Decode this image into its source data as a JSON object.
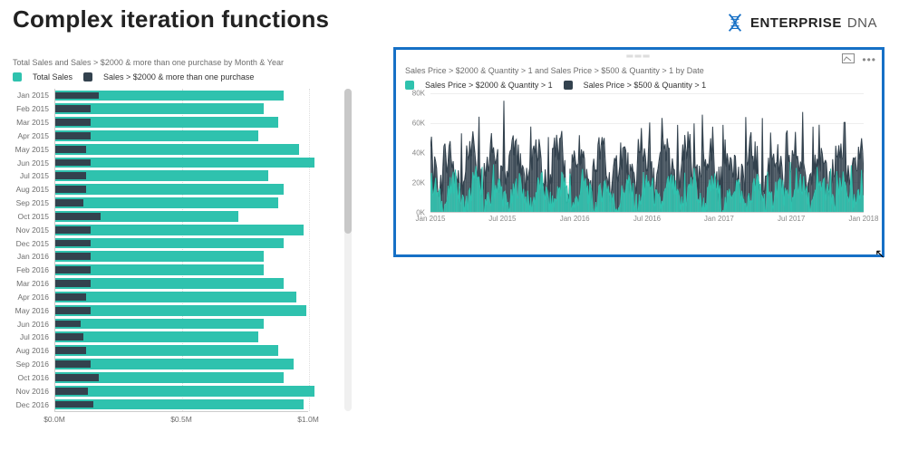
{
  "header": {
    "title": "Complex iteration functions"
  },
  "brand": {
    "text_main": "ENTERPRISE",
    "text_accent": "DNA"
  },
  "left": {
    "title": "Total Sales and Sales > $2000 & more than one purchase by Month & Year",
    "legend1": "Total Sales",
    "legend2": "Sales > $2000 & more than one purchase",
    "xTicks": {
      "t0": "$0.0M",
      "t1": "$0.5M",
      "t2": "$1.0M"
    }
  },
  "right": {
    "title": "Sales Price > $2000 & Quantity > 1 and Sales Price > $500 & Quantity > 1 by Date",
    "legend1": "Sales Price > $2000 & Quantity > 1",
    "legend2": "Sales Price > $500 & Quantity > 1",
    "yTicks": {
      "y0": "0K",
      "y20": "20K",
      "y40": "40K",
      "y60": "60K",
      "y80": "80K"
    },
    "xTicks": {
      "x0": "Jan 2015",
      "x1": "Jul 2015",
      "x2": "Jan 2016",
      "x3": "Jul 2016",
      "x4": "Jan 2017",
      "x5": "Jul 2017",
      "x6": "Jan 2018"
    }
  },
  "chart_data": [
    {
      "id": "left_bar",
      "type": "bar",
      "orientation": "horizontal",
      "title": "Total Sales and Sales > $2000 & more than one purchase by Month & Year",
      "xlabel": "",
      "ylabel": "",
      "xlim": [
        0,
        1.0
      ],
      "x_tick_labels": [
        "$0.0M",
        "$0.5M",
        "$1.0M"
      ],
      "categories": [
        "Jan 2015",
        "Feb 2015",
        "Mar 2015",
        "Apr 2015",
        "May 2015",
        "Jun 2015",
        "Jul 2015",
        "Aug 2015",
        "Sep 2015",
        "Oct 2015",
        "Nov 2015",
        "Dec 2015",
        "Jan 2016",
        "Feb 2016",
        "Mar 2016",
        "Apr 2016",
        "May 2016",
        "Jun 2016",
        "Jul 2016",
        "Aug 2016",
        "Sep 2016",
        "Oct 2016",
        "Nov 2016",
        "Dec 2016"
      ],
      "series": [
        {
          "name": "Total Sales",
          "color": "#2fc2ae",
          "values": [
            0.9,
            0.82,
            0.88,
            0.8,
            0.96,
            1.02,
            0.84,
            0.9,
            0.88,
            0.72,
            0.98,
            0.9,
            0.82,
            0.82,
            0.9,
            0.95,
            0.99,
            0.82,
            0.8,
            0.88,
            0.94,
            0.9,
            1.02,
            0.98
          ]
        },
        {
          "name": "Sales > $2000 & more than one purchase",
          "color": "#33424e",
          "values": [
            0.17,
            0.14,
            0.14,
            0.14,
            0.12,
            0.14,
            0.12,
            0.12,
            0.11,
            0.18,
            0.14,
            0.14,
            0.14,
            0.14,
            0.14,
            0.12,
            0.14,
            0.1,
            0.11,
            0.12,
            0.14,
            0.17,
            0.13,
            0.15
          ]
        }
      ]
    },
    {
      "id": "right_line",
      "type": "line",
      "title": "Sales Price > $2000 & Quantity > 1 and Sales Price > $500 & Quantity > 1 by Date",
      "xlabel": "",
      "ylabel": "",
      "ylim": [
        0,
        80
      ],
      "y_tick_labels": [
        "0K",
        "20K",
        "40K",
        "60K",
        "80K"
      ],
      "x_tick_labels": [
        "Jan 2015",
        "Jul 2015",
        "Jan 2016",
        "Jul 2016",
        "Jan 2017",
        "Jul 2017",
        "Jan 2018"
      ],
      "note": "Dense daily series ~1100 points Jan 2015–Jan 2018. Typical range series1 0–30K, series2 0–55K with spikes to ~60–75K.",
      "series": [
        {
          "name": "Sales Price > $2000 & Quantity > 1",
          "color": "#2fc2ae",
          "typical_range": [
            0,
            30
          ],
          "spike_max": 38
        },
        {
          "name": "Sales Price > $500 & Quantity > 1",
          "color": "#33424e",
          "typical_range": [
            0,
            55
          ],
          "spike_max": 75
        }
      ]
    }
  ]
}
